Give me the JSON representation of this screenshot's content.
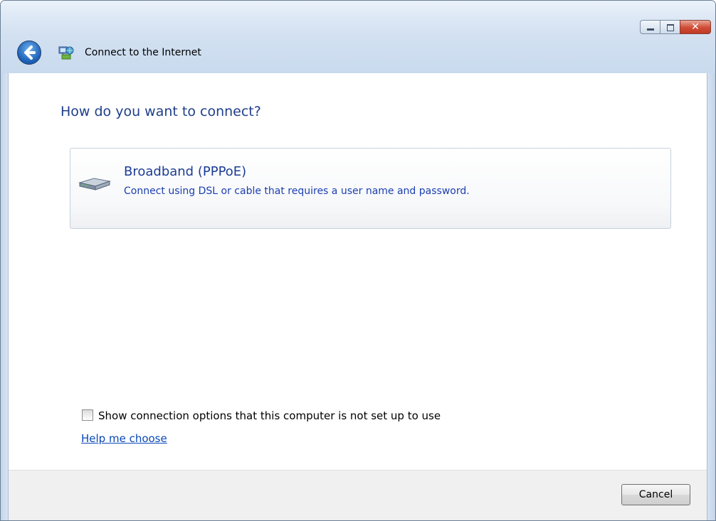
{
  "window": {
    "title": "Connect to the Internet",
    "controls": {
      "minimize": "minimize-icon",
      "maximize": "maximize-icon",
      "close": "close-icon"
    }
  },
  "main": {
    "heading": "How do you want to connect?",
    "options": [
      {
        "title": "Broadband (PPPoE)",
        "description": "Connect using DSL or cable that requires a user name and password.",
        "icon": "broadband-modem-icon"
      }
    ],
    "show_options": {
      "label": "Show connection options that this computer is not set up to use",
      "checked": false
    },
    "help_link": "Help me choose"
  },
  "footer": {
    "cancel_label": "Cancel"
  },
  "colors": {
    "heading": "#1f3e8a",
    "link": "#0b47b8",
    "chrome": "#d3e1f1"
  }
}
